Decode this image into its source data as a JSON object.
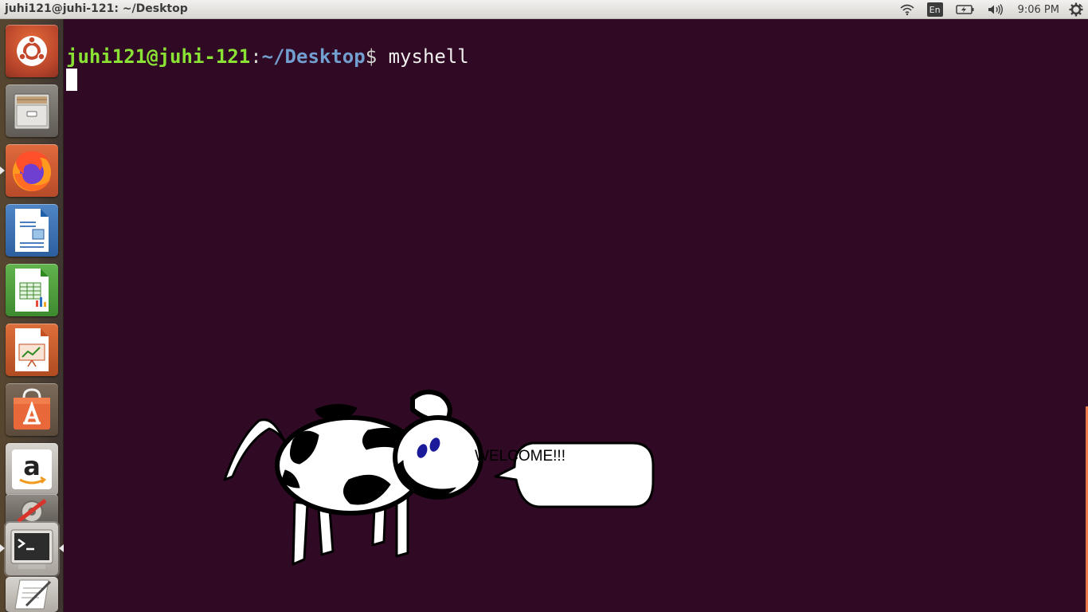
{
  "window": {
    "title": "juhi121@juhi-121: ~/Desktop"
  },
  "panel": {
    "indicators": [
      "wifi-icon",
      "keyboard-layout",
      "battery-icon",
      "volume-icon",
      "clock",
      "settings-gear-icon"
    ],
    "keyboard_layout": "En",
    "clock": "9:06 PM"
  },
  "launcher": {
    "items": [
      {
        "name": "Ubuntu Dash",
        "icon": "ubuntu-logo-icon"
      },
      {
        "name": "Files",
        "icon": "file-cabinet-icon"
      },
      {
        "name": "Firefox Web Browser",
        "icon": "firefox-icon",
        "running": true
      },
      {
        "name": "LibreOffice Writer",
        "icon": "writer-document-icon"
      },
      {
        "name": "LibreOffice Calc",
        "icon": "calc-spreadsheet-icon"
      },
      {
        "name": "LibreOffice Impress",
        "icon": "impress-presentation-icon"
      },
      {
        "name": "Ubuntu Software",
        "icon": "software-center-bag-icon"
      },
      {
        "name": "Amazon",
        "icon": "amazon-icon"
      },
      {
        "name": "System Settings",
        "icon": "settings-tools-icon"
      },
      {
        "name": "Terminal",
        "icon": "terminal-icon",
        "running": true,
        "focused": true
      },
      {
        "name": "Text Editor",
        "icon": "text-editor-icon"
      }
    ]
  },
  "terminal": {
    "user_host": "juhi121@juhi-121",
    "colon": ":",
    "path": "~/Desktop",
    "dollar": "$ ",
    "command": "myshell",
    "colors": {
      "background": "#300a24",
      "user": "#8ae234",
      "path": "#729fcf",
      "text": "#eeeeec"
    }
  },
  "welcome": {
    "bubble_text": "WELCOME!!!"
  }
}
